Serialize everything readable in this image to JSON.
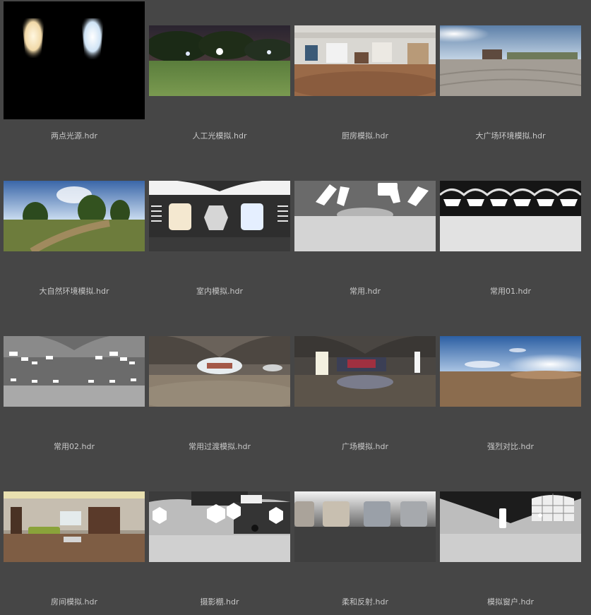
{
  "files": [
    {
      "name": "两点光源.hdr",
      "preview": "two-point-light-preview"
    },
    {
      "name": "人工光模拟.hdr",
      "preview": "artificial-light-night-park-preview"
    },
    {
      "name": "厨房模拟.hdr",
      "preview": "kitchen-interior-preview"
    },
    {
      "name": "大广场环境模拟.hdr",
      "preview": "large-plaza-preview"
    },
    {
      "name": "大自然环境模拟.hdr",
      "preview": "nature-environment-preview"
    },
    {
      "name": "室内模拟.hdr",
      "preview": "indoor-studio-preview"
    },
    {
      "name": "常用.hdr",
      "preview": "common-studio-preview"
    },
    {
      "name": "常用01.hdr",
      "preview": "common-01-preview"
    },
    {
      "name": "常用02.hdr",
      "preview": "common-02-preview"
    },
    {
      "name": "常用过渡模拟.hdr",
      "preview": "transition-tunnel-preview"
    },
    {
      "name": "广场模拟.hdr",
      "preview": "plaza-interior-preview"
    },
    {
      "name": "强烈对比.hdr",
      "preview": "strong-contrast-desert-preview"
    },
    {
      "name": "房间模拟.hdr",
      "preview": "room-interior-preview"
    },
    {
      "name": "摄影棚.hdr",
      "preview": "photo-studio-preview"
    },
    {
      "name": "柔和反射.hdr",
      "preview": "soft-reflection-preview"
    },
    {
      "name": "模拟窗户.hdr",
      "preview": "window-simulation-preview"
    }
  ]
}
